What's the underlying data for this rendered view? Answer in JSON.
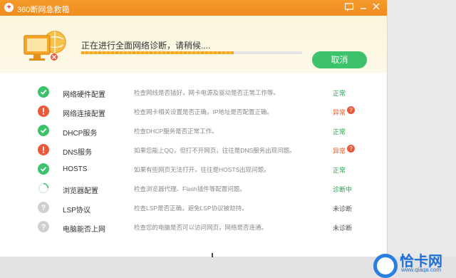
{
  "window": {
    "title": "360断网急救箱"
  },
  "colors": {
    "ok": "#3cc26a",
    "error": "#e85a3a",
    "pending": "#cfcfcf",
    "warn_text": "#e35a2b",
    "ok_text": "#23a24d"
  },
  "header": {
    "status": "正在进行全面网络诊断，请稍候....",
    "progress": 0.69,
    "cancel_label": "取消"
  },
  "items": [
    {
      "name": "网络硬件配置",
      "desc": "检查网线是否插好，网卡电源及驱动是否正常工作等。",
      "result": "正常",
      "state": "ok"
    },
    {
      "name": "网络连接配置",
      "desc": "检查网卡相关设置是否正确，IP地址是否配置正确。",
      "result": "异常",
      "state": "error"
    },
    {
      "name": "DHCP服务",
      "desc": "检查DHCP服务是否正常工作。",
      "result": "正常",
      "state": "ok"
    },
    {
      "name": "DNS服务",
      "desc": "如果您能上QQ，但打不开网页，往往是DNS服务出现问题。",
      "result": "异常",
      "state": "error"
    },
    {
      "name": "HOSTS",
      "desc": "如果有些网页无法打开，往往是HOSTS出现问题。",
      "result": "正常",
      "state": "ok"
    },
    {
      "name": "浏览器配置",
      "desc": "检查浏览器代理、Flash插件等配置问题。",
      "result": "诊断中",
      "state": "loading"
    },
    {
      "name": "LSP协议",
      "desc": "检查LSP是否正确，避免LSP协议被劫持。",
      "result": "未诊断",
      "state": "pending"
    },
    {
      "name": "电脑能否上网",
      "desc": "检查您的电脑是否可以访问网页，网络是否连通。",
      "result": "未诊断",
      "state": "pending"
    }
  ],
  "watermark": {
    "text": "恰卡网",
    "sub": "www.qiaqa.com"
  }
}
